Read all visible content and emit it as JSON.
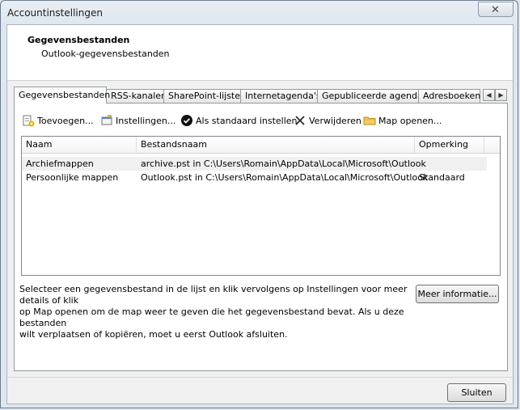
{
  "window": {
    "title": "Accountinstellingen",
    "close_symbol": "✕"
  },
  "header": {
    "title": "Gegevensbestanden",
    "subtitle": "Outlook-gegevensbestanden"
  },
  "tabs": [
    {
      "label": "Gegevensbestanden",
      "active": true
    },
    {
      "label": "RSS-kanalen"
    },
    {
      "label": "SharePoint-lijsten"
    },
    {
      "label": "Internetagenda's"
    },
    {
      "label": "Gepubliceerde agenda's"
    },
    {
      "label": "Adresboeken"
    }
  ],
  "tab_scroll": {
    "left": "◀",
    "right": "▶"
  },
  "toolbar": {
    "add": "Toevoegen...",
    "settings": "Instellingen...",
    "default": "Als standaard instellen",
    "remove": "Verwijderen",
    "open_folder": "Map openen..."
  },
  "table": {
    "columns": [
      "Naam",
      "Bestandsnaam",
      "Opmerking"
    ],
    "rows": [
      {
        "name": "Archiefmappen",
        "file": "archive.pst in C:\\Users\\Romain\\AppData\\Local\\Microsoft\\Outlook",
        "note": ""
      },
      {
        "name": "Persoonlijke mappen",
        "file": "Outlook.pst in C:\\Users\\Romain\\AppData\\Local\\Microsoft\\Outlook",
        "note": "Standaard"
      }
    ]
  },
  "info": {
    "text_1": "Selecteer een gegevensbestand in de lijst en klik vervolgens op Instellingen voor meer details of klik",
    "text_2": "op Map openen om de map weer te geven die het gegevensbestand bevat. Als u deze bestanden",
    "text_3": "wilt verplaatsen of kopiëren, moet u eerst Outlook afsluiten.",
    "more_button": "Meer informatie..."
  },
  "footer": {
    "close_button": "Sluiten"
  }
}
